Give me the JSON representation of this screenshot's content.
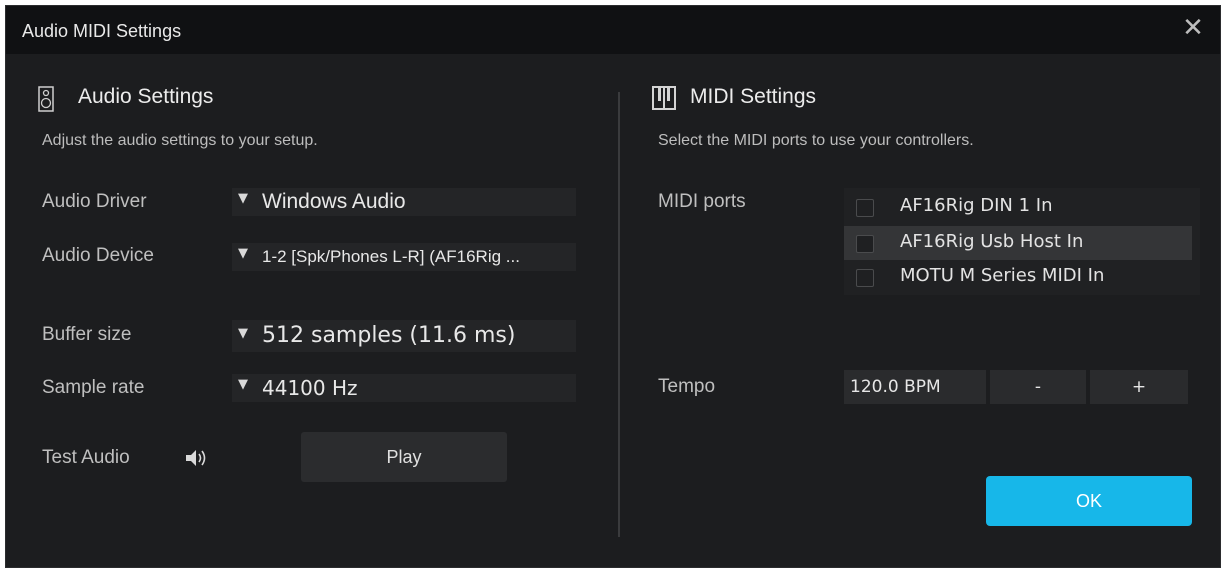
{
  "window": {
    "title": "Audio MIDI Settings",
    "close_label": "✕"
  },
  "audio": {
    "icon": "speaker-icon",
    "heading": "Audio Settings",
    "subtitle": "Adjust the audio settings to your setup.",
    "driver_label": "Audio Driver",
    "driver_value": "Windows Audio",
    "device_label": "Audio Device",
    "device_value": "1-2 [Spk/Phones L-R] (AF16Rig ...",
    "buffer_label": "Buffer size",
    "buffer_value": "512 samples (11.6 ms)",
    "rate_label": "Sample rate",
    "rate_value": "44100 Hz",
    "test_label": "Test Audio",
    "play_label": "Play"
  },
  "midi": {
    "icon": "piano-icon",
    "heading": "MIDI Settings",
    "subtitle": "Select the MIDI ports to use your controllers.",
    "ports_label": "MIDI ports",
    "ports": [
      {
        "name": "AF16Rig DIN 1 In",
        "checked": false
      },
      {
        "name": "AF16Rig Usb Host In",
        "checked": false
      },
      {
        "name": "MOTU M Series MIDI In",
        "checked": false
      }
    ],
    "tempo_label": "Tempo",
    "tempo_value": "120.0 BPM",
    "minus_label": "-",
    "plus_label": "+"
  },
  "ok_label": "OK",
  "colors": {
    "accent": "#17b7e9",
    "background": "#1c1d1f",
    "titlebar": "#101113"
  }
}
